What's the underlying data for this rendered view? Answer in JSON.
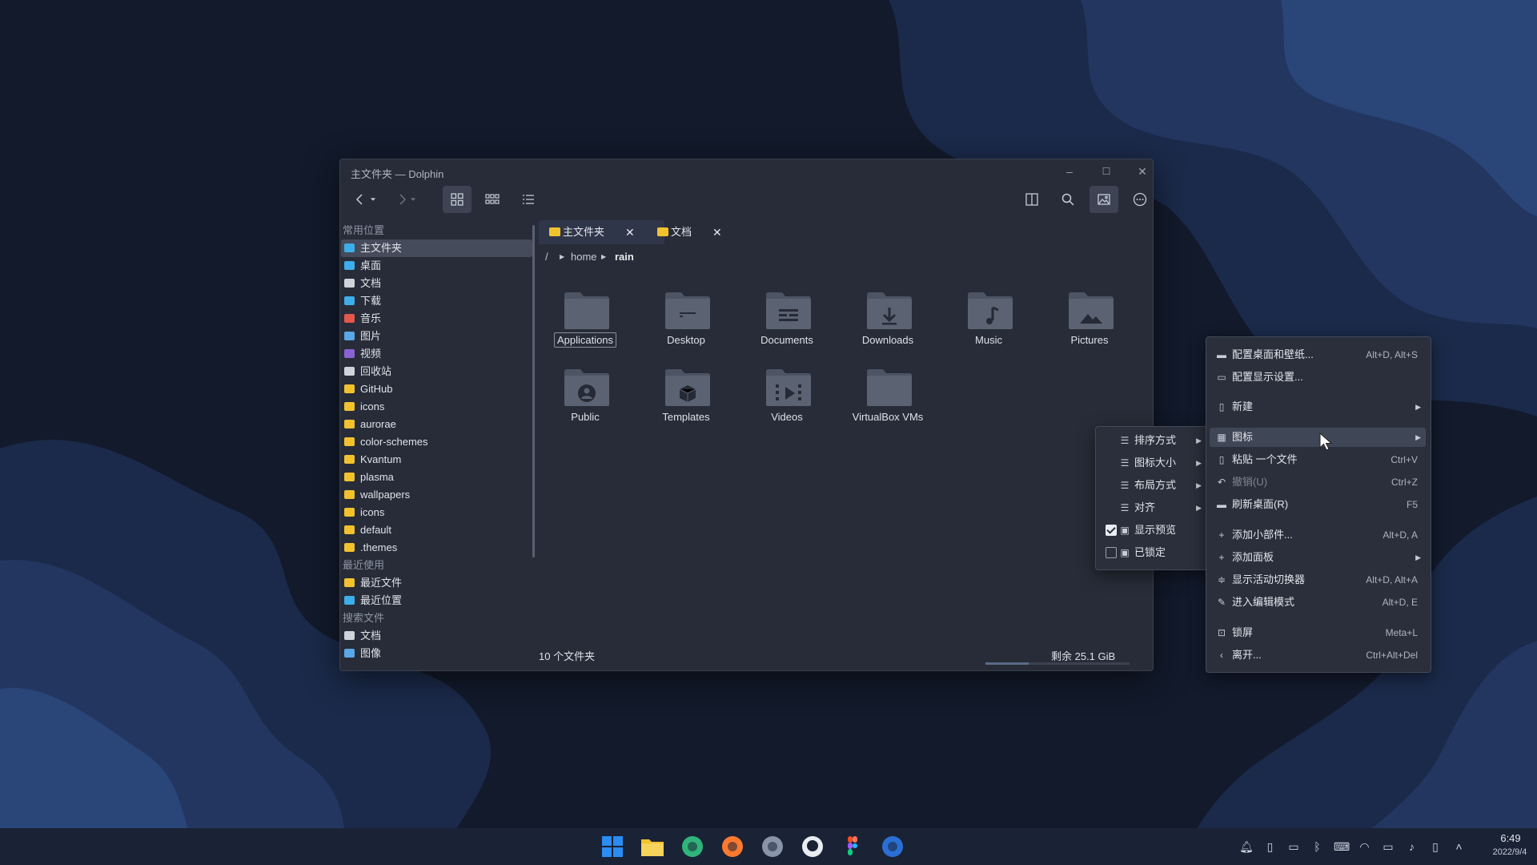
{
  "window": {
    "title": "主文件夹 — Dolphin",
    "minimize": "–",
    "maximize": "☐",
    "close": "✕"
  },
  "sidebar": {
    "sections": [
      {
        "label": "常用位置",
        "items": [
          {
            "label": "主文件夹",
            "icon": "home-icon",
            "color": "#3daee9",
            "selected": true
          },
          {
            "label": "桌面",
            "icon": "desktop-icon",
            "color": "#3daee9"
          },
          {
            "label": "文档",
            "icon": "document-icon",
            "color": "#cfd3da"
          },
          {
            "label": "下载",
            "icon": "download-icon",
            "color": "#3daee9"
          },
          {
            "label": "音乐",
            "icon": "music-icon",
            "color": "#e4574d"
          },
          {
            "label": "图片",
            "icon": "picture-icon",
            "color": "#5aa6e8"
          },
          {
            "label": "视频",
            "icon": "video-icon",
            "color": "#8a63d2"
          },
          {
            "label": "回收站",
            "icon": "trash-icon",
            "color": "#cfd3da"
          },
          {
            "label": "GitHub",
            "icon": "folder-icon",
            "color": "#f2c22e"
          },
          {
            "label": "icons",
            "icon": "folder-icon",
            "color": "#f2c22e"
          },
          {
            "label": "aurorae",
            "icon": "folder-icon",
            "color": "#f2c22e"
          },
          {
            "label": "color-schemes",
            "icon": "folder-icon",
            "color": "#f2c22e"
          },
          {
            "label": "Kvantum",
            "icon": "folder-icon",
            "color": "#f2c22e"
          },
          {
            "label": "plasma",
            "icon": "folder-icon",
            "color": "#f2c22e"
          },
          {
            "label": "wallpapers",
            "icon": "folder-icon",
            "color": "#f2c22e"
          },
          {
            "label": "icons",
            "icon": "folder-icon",
            "color": "#f2c22e"
          },
          {
            "label": "default",
            "icon": "folder-icon",
            "color": "#f2c22e"
          },
          {
            "label": ".themes",
            "icon": "folder-icon",
            "color": "#f2c22e"
          }
        ]
      },
      {
        "label": "最近使用",
        "items": [
          {
            "label": "最近文件",
            "icon": "recent-files-icon",
            "color": "#f2c22e"
          },
          {
            "label": "最近位置",
            "icon": "recent-locations-icon",
            "color": "#3daee9"
          }
        ]
      },
      {
        "label": "搜索文件",
        "items": [
          {
            "label": "文档",
            "icon": "document-icon",
            "color": "#cfd3da"
          },
          {
            "label": "图像",
            "icon": "picture-icon",
            "color": "#5aa6e8"
          }
        ]
      }
    ]
  },
  "tabs": [
    {
      "label": "主文件夹",
      "active": true,
      "close": "✕"
    },
    {
      "label": "文档",
      "active": false,
      "close": "✕"
    }
  ],
  "breadcrumb": {
    "root": "/",
    "segments": [
      "home",
      "rain"
    ]
  },
  "folders": [
    {
      "label": "Applications",
      "glyph": "",
      "focused": true
    },
    {
      "label": "Desktop",
      "glyph": "desktop"
    },
    {
      "label": "Documents",
      "glyph": "documents"
    },
    {
      "label": "Downloads",
      "glyph": "downloads"
    },
    {
      "label": "Music",
      "glyph": "music"
    },
    {
      "label": "Pictures",
      "glyph": "pictures"
    },
    {
      "label": "Public",
      "glyph": "public"
    },
    {
      "label": "Templates",
      "glyph": "templates"
    },
    {
      "label": "Videos",
      "glyph": "videos"
    },
    {
      "label": "VirtualBox VMs",
      "glyph": ""
    }
  ],
  "status": {
    "count": "10 个文件夹",
    "free": "剩余 25.1 GiB",
    "used_fraction": 0.3
  },
  "desktop_menu": {
    "items": [
      {
        "label": "配置桌面和壁纸...",
        "shortcut": "Alt+D, Alt+S",
        "icon": "wallpaper-icon"
      },
      {
        "label": "配置显示设置...",
        "shortcut": "",
        "icon": "display-icon"
      },
      {
        "label": "新建",
        "shortcut": "",
        "icon": "new-file-icon",
        "submenu": true
      },
      {
        "label": "图标",
        "shortcut": "",
        "icon": "icons-icon",
        "submenu": true,
        "highlighted": true
      },
      {
        "label": "粘贴 一个文件",
        "shortcut": "Ctrl+V",
        "icon": "paste-icon"
      },
      {
        "label": "撤销(U)",
        "shortcut": "Ctrl+Z",
        "icon": "undo-icon",
        "disabled": true
      },
      {
        "label": "刷新桌面(R)",
        "shortcut": "F5",
        "icon": "refresh-icon"
      },
      {
        "label": "添加小部件...",
        "shortcut": "Alt+D, A",
        "icon": "add-icon"
      },
      {
        "label": "添加面板",
        "shortcut": "",
        "icon": "add-icon",
        "submenu": true
      },
      {
        "label": "显示活动切换器",
        "shortcut": "Alt+D, Alt+A",
        "icon": "activities-icon"
      },
      {
        "label": "进入编辑模式",
        "shortcut": "Alt+D, E",
        "icon": "edit-icon"
      },
      {
        "label": "锁屏",
        "shortcut": "Meta+L",
        "icon": "lock-icon"
      },
      {
        "label": "离开...",
        "shortcut": "Ctrl+Alt+Del",
        "icon": "leave-icon"
      }
    ]
  },
  "icons_submenu": {
    "items": [
      {
        "label": "排序方式",
        "icon": "sort-icon",
        "submenu": true
      },
      {
        "label": "图标大小",
        "icon": "icon-size-icon",
        "submenu": true
      },
      {
        "label": "布局方式",
        "icon": "layout-icon",
        "submenu": true
      },
      {
        "label": "对齐",
        "icon": "align-icon",
        "submenu": true
      },
      {
        "label": "显示预览",
        "icon": "preview-icon",
        "checkbox": true,
        "checked": true
      },
      {
        "label": "已锁定",
        "icon": "lock-icon",
        "checkbox": true,
        "checked": false
      }
    ]
  },
  "taskbar": {
    "apps": [
      {
        "name": "start-menu-icon",
        "color": "#2b8cf2"
      },
      {
        "name": "file-manager-icon",
        "color": "#f2c22e"
      },
      {
        "name": "edge-dev-icon",
        "color": "#2fb57a"
      },
      {
        "name": "firefox-icon",
        "color": "#ff7a2f"
      },
      {
        "name": "settings-icon",
        "color": "#8a94a8"
      },
      {
        "name": "github-icon",
        "color": "#e9ecf1"
      },
      {
        "name": "figma-icon",
        "color": "#f24e1e"
      },
      {
        "name": "store-icon",
        "color": "#2b6fd6"
      }
    ],
    "tray": [
      "notification-icon",
      "clipboard-icon",
      "battery-charging-icon",
      "bluetooth-icon",
      "keyboard-icon",
      "wifi-icon",
      "network-icon",
      "volume-icon",
      "phone-icon",
      "expand-tray-icon"
    ],
    "time": "6:49",
    "date": "2022/9/4"
  }
}
